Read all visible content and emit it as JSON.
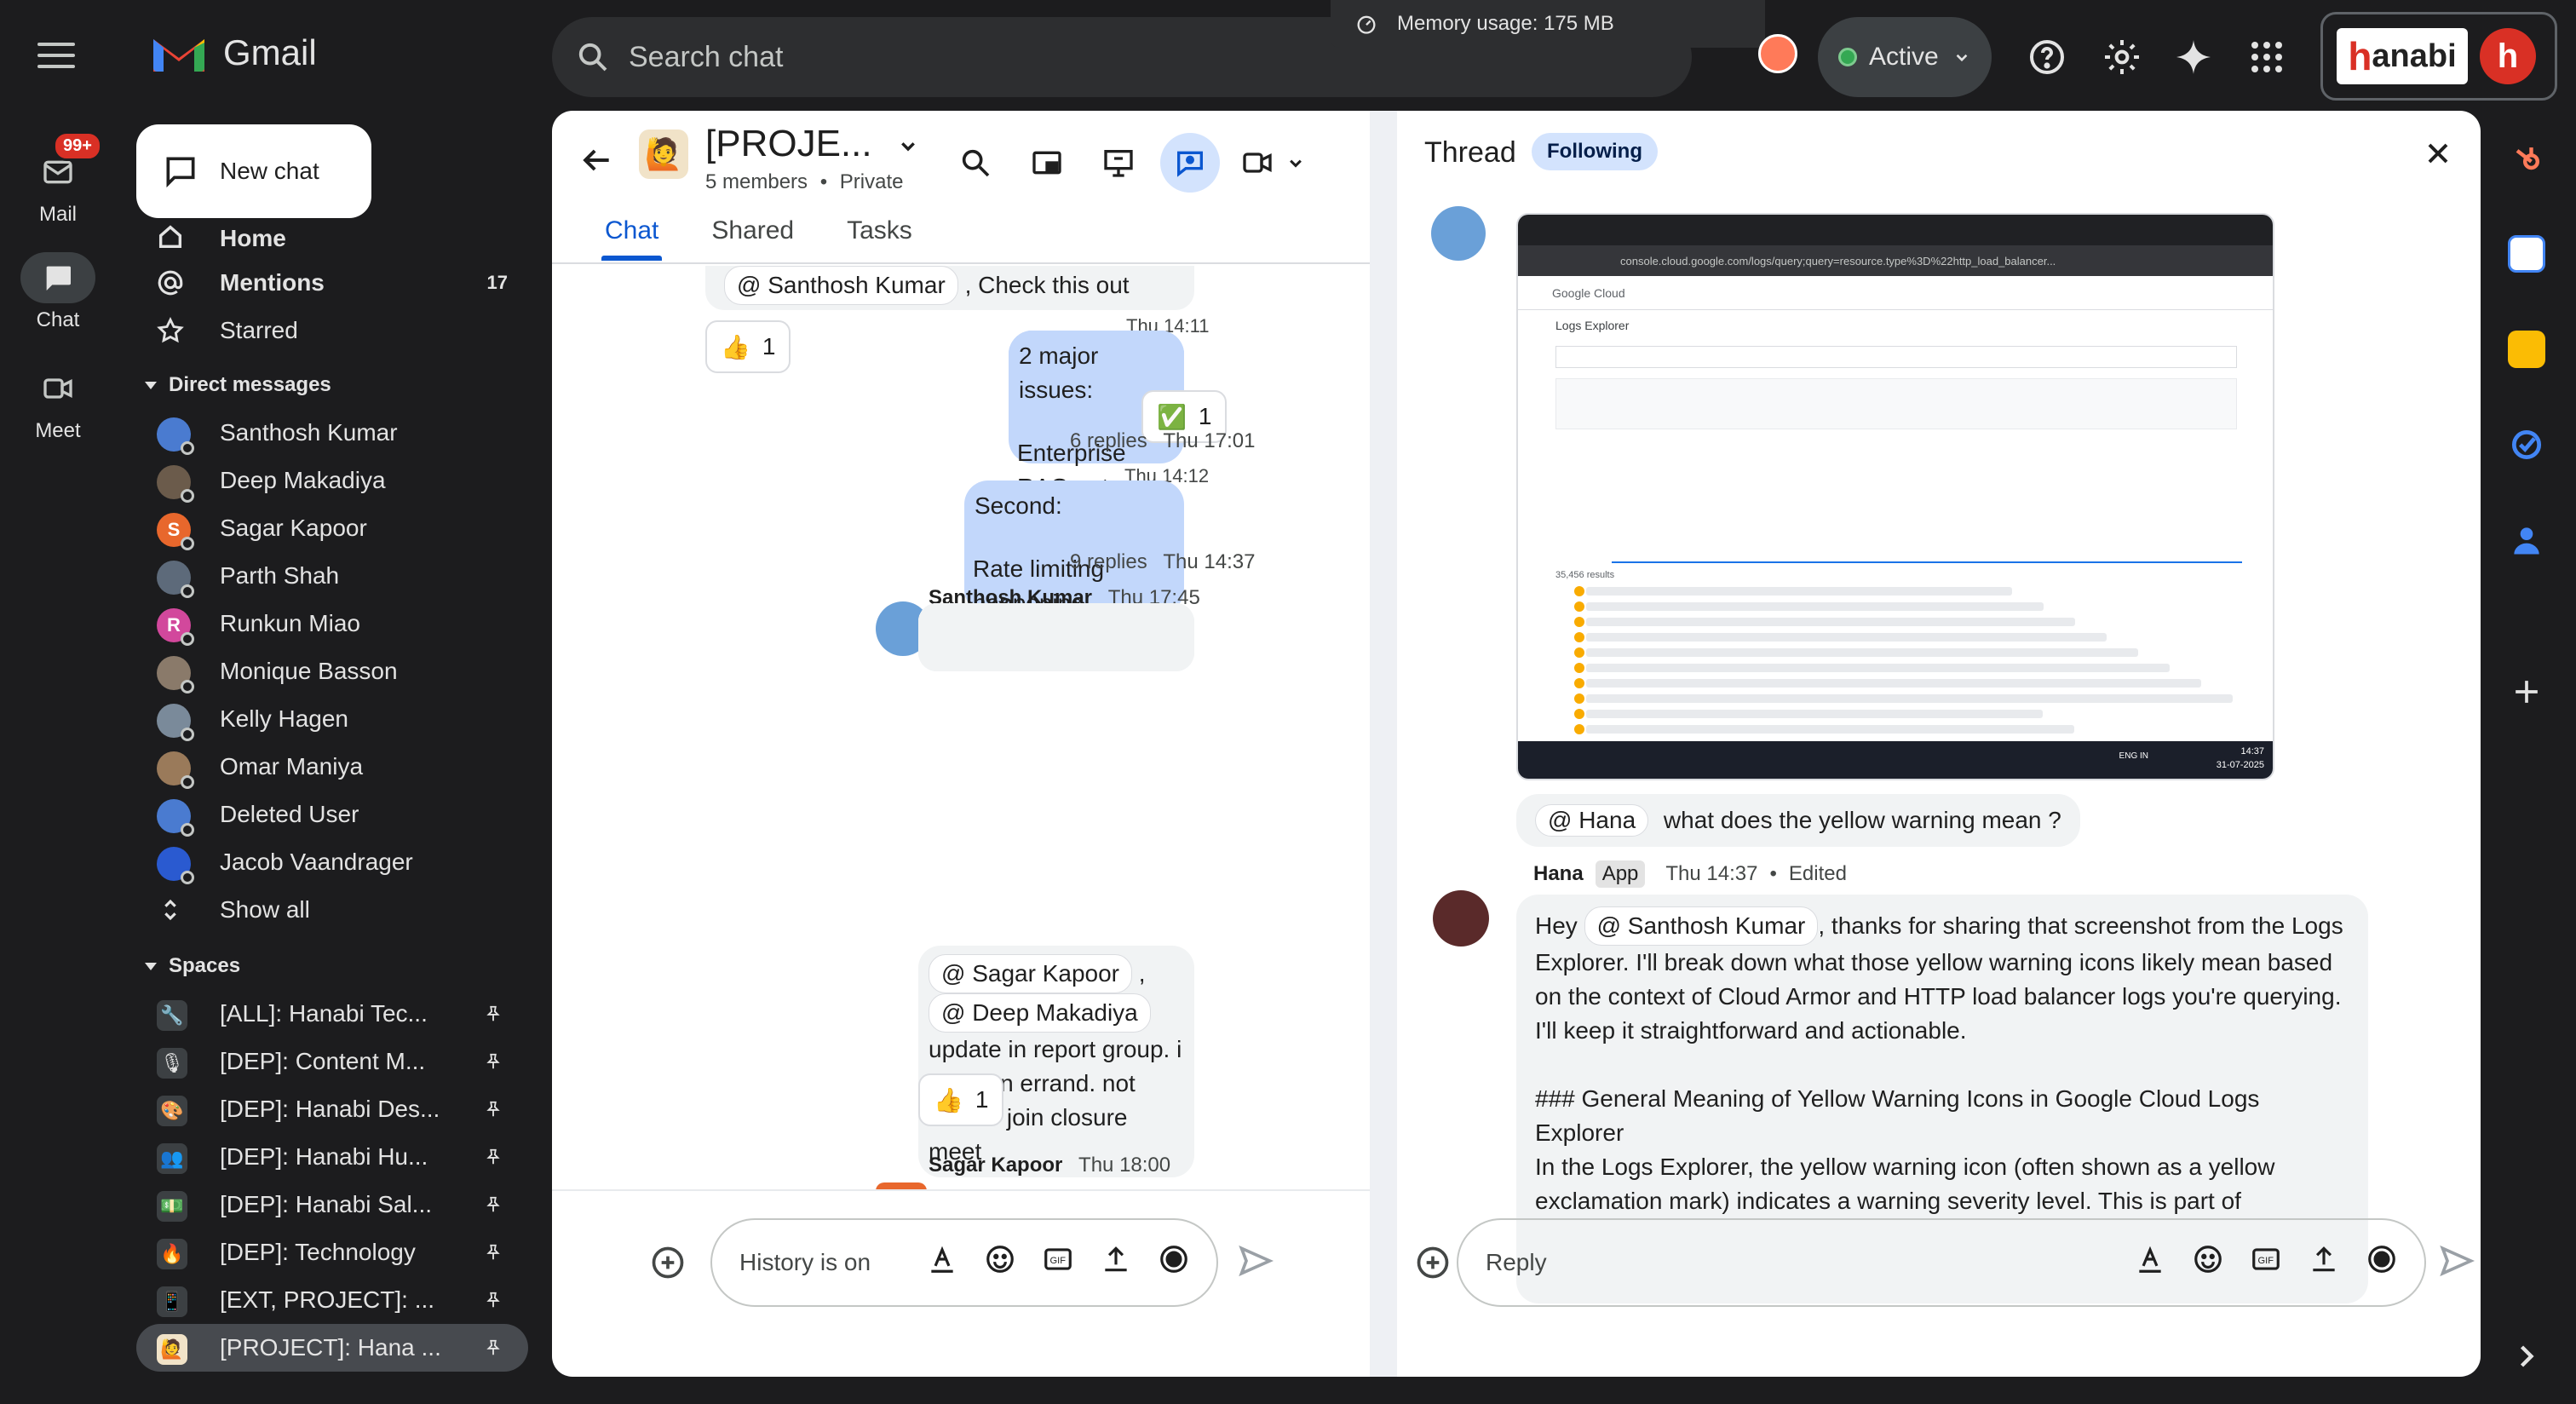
{
  "rail": {
    "mail_label": "Mail",
    "mail_badge": "99+",
    "chat_label": "Chat",
    "meet_label": "Meet"
  },
  "app": {
    "name": "Gmail"
  },
  "search": {
    "placeholder": "Search chat"
  },
  "memory_tip": "Memory usage: 175 MB",
  "status": {
    "label": "Active",
    "color": "#34a853"
  },
  "account": {
    "brand": "anabi",
    "initial": "h"
  },
  "sidebar": {
    "new_chat": "New chat",
    "home": "Home",
    "mentions": "Mentions",
    "mentions_count": "17",
    "starred": "Starred",
    "dm_header": "Direct messages",
    "dms": [
      {
        "name": "Santhosh Kumar",
        "initial": "",
        "color": "#4a7bd0"
      },
      {
        "name": "Deep Makadiya",
        "initial": "",
        "color": "#6b5b4b"
      },
      {
        "name": "Sagar Kapoor",
        "initial": "S",
        "color": "#e8672c"
      },
      {
        "name": "Parth Shah",
        "initial": "",
        "color": "#5d6a7a"
      },
      {
        "name": "Runkun Miao",
        "initial": "R",
        "color": "#d2489c"
      },
      {
        "name": "Monique Basson",
        "initial": "",
        "color": "#8a7a6a"
      },
      {
        "name": "Kelly Hagen",
        "initial": "",
        "color": "#7a8a9a"
      },
      {
        "name": "Omar Maniya",
        "initial": "",
        "color": "#9a7a5a"
      },
      {
        "name": "Deleted User",
        "initial": "",
        "color": "#4a7bd0"
      },
      {
        "name": "Jacob Vaandrager",
        "initial": "",
        "color": "#2a5ad0"
      }
    ],
    "show_all": "Show all",
    "spaces_header": "Spaces",
    "spaces": [
      {
        "name": "[ALL]: Hanabi Tec...",
        "emoji": "🔧",
        "bg": "#3c4043"
      },
      {
        "name": "[DEP]: Content M...",
        "emoji": "🎙",
        "bg": "#3c4043"
      },
      {
        "name": "[DEP]: Hanabi Des...",
        "emoji": "🎨",
        "bg": "#3c4043"
      },
      {
        "name": "[DEP]: Hanabi Hu...",
        "emoji": "👥",
        "bg": "#3c4043"
      },
      {
        "name": "[DEP]: Hanabi Sal...",
        "emoji": "💵",
        "bg": "#3c4043"
      },
      {
        "name": "[DEP]: Technology",
        "emoji": "🔥",
        "bg": "#3c4043"
      },
      {
        "name": "[EXT, PROJECT]: ...",
        "emoji": "📱",
        "bg": "#3c4043"
      },
      {
        "name": "[PROJECT]: Hana ...",
        "emoji": "🙋",
        "bg": "#f1e3c8"
      }
    ]
  },
  "chat": {
    "title": "[PROJE...",
    "members": "5 members",
    "privacy": "Private",
    "tabs": [
      "Chat",
      "Shared",
      "Tasks"
    ],
    "m1": {
      "mention": "@ Santhosh Kumar",
      "text": ", Check this out",
      "reaction_emoji": "👍",
      "reaction_count": "1"
    },
    "m2": {
      "time": "Thu 14:11",
      "line1": "2 major issues:",
      "line2": "Enterprise RAG not working",
      "reaction_emoji": "✅",
      "reaction_count": "1",
      "replies": "6 replies",
      "reply_time": "Thu 17:01"
    },
    "m3": {
      "time": "Thu 14:12",
      "line1": "Second:",
      "line2": "Rate limiting happening somewhere",
      "replies": "9 replies",
      "reply_time": "Thu 14:37"
    },
    "m4": {
      "sender": "Santhosh Kumar",
      "time": "Thu 17:45",
      "mention1": "@ Sagar Kapoor",
      "sep": ",",
      "mention2": "@ Deep Makadiya",
      "text": "update in report group. i have an errand. not able to join closure meet",
      "reaction_emoji": "👍",
      "reaction_count": "1"
    },
    "m5": {
      "sender": "Sagar Kapoor",
      "time": "Thu 18:00"
    },
    "composer_placeholder": "History is on"
  },
  "thread": {
    "title": "Thread",
    "following": "Following",
    "q_mention": "@ Hana",
    "q_text": "what does the yellow warning mean ?",
    "reply_sender": "Hana",
    "reply_tag": "App",
    "reply_time": "Thu 14:37",
    "reply_edited": "Edited",
    "reply_p1_a": "Hey ",
    "reply_p1_mention": "@ Santhosh Kumar",
    "reply_p1_b": ", thanks for sharing that screenshot from the Logs Explorer. I'll break down what those yellow warning icons likely mean based on the context of Cloud Armor and HTTP load balancer logs you're querying. I'll keep it straightforward and actionable.",
    "reply_p2": "### General Meaning of Yellow Warning Icons in Google Cloud Logs Explorer",
    "reply_p3": "In the Logs Explorer, the yellow warning icon (often shown as a yellow exclamation mark) indicates a warning severity level. This is part of",
    "composer_placeholder": "Reply",
    "screenshot": {
      "url": "console.cloud.google.com/logs/query;query=resource.type%3D%22http_load_balancer...",
      "brand": "Google Cloud",
      "page": "Logs Explorer",
      "results": "35,456 results",
      "clock": "14:37",
      "date": "31-07-2025",
      "lang": "ENG IN"
    }
  }
}
